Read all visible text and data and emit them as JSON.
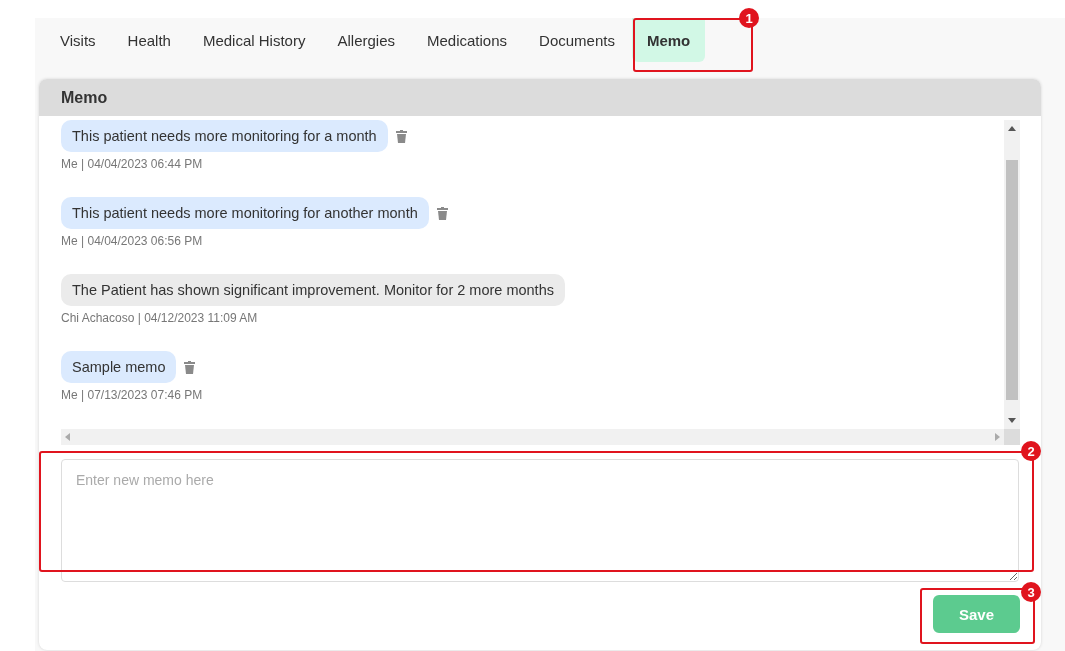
{
  "tabs": [
    {
      "label": "Visits",
      "selected": false
    },
    {
      "label": "Health",
      "selected": false
    },
    {
      "label": "Medical History",
      "selected": false
    },
    {
      "label": "Allergies",
      "selected": false
    },
    {
      "label": "Medications",
      "selected": false
    },
    {
      "label": "Documents",
      "selected": false
    },
    {
      "label": "Memo",
      "selected": true
    }
  ],
  "memo": {
    "title": "Memo",
    "messages": [
      {
        "text": "This patient needs more monitoring for a month",
        "meta": "Me | 04/04/2023 06:44 PM",
        "mine": true
      },
      {
        "text": "This patient needs more monitoring for another month",
        "meta": "Me | 04/04/2023 06:56 PM",
        "mine": true
      },
      {
        "text": "The Patient has shown significant improvement. Monitor for 2 more months",
        "meta": "Chi Achacoso | 04/12/2023 11:09 AM",
        "mine": false
      },
      {
        "text": "Sample memo",
        "meta": "Me | 07/13/2023 07:46 PM",
        "mine": true
      }
    ],
    "input": {
      "placeholder": "Enter new memo here"
    },
    "save_button": "Save"
  },
  "annotations": [
    {
      "label": "1"
    },
    {
      "label": "2"
    },
    {
      "label": "3"
    }
  ]
}
